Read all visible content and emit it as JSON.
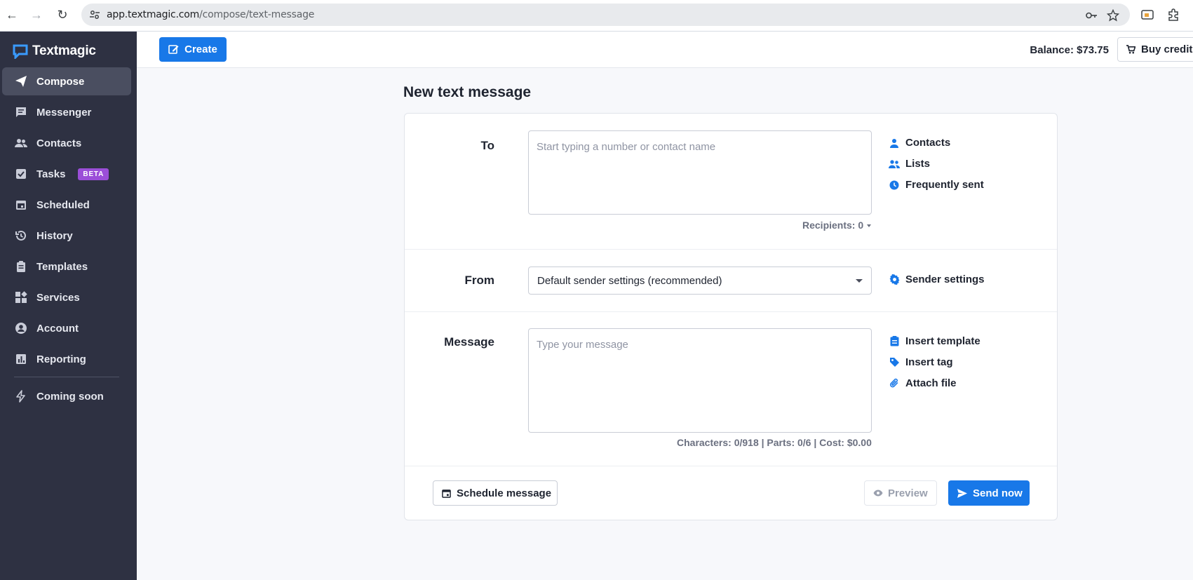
{
  "browser": {
    "url_host": "app.textmagic.com",
    "url_path": "/compose/text-message"
  },
  "brand": {
    "name": "Textmagic"
  },
  "sidebar": {
    "items": [
      {
        "label": "Compose",
        "icon": "send-icon",
        "active": true
      },
      {
        "label": "Messenger",
        "icon": "chat-icon"
      },
      {
        "label": "Contacts",
        "icon": "people-icon"
      },
      {
        "label": "Tasks",
        "icon": "checkbox-icon",
        "badge": "BETA"
      },
      {
        "label": "Scheduled",
        "icon": "calendar-icon"
      },
      {
        "label": "History",
        "icon": "history-icon"
      },
      {
        "label": "Templates",
        "icon": "clipboard-icon"
      },
      {
        "label": "Services",
        "icon": "widgets-icon"
      },
      {
        "label": "Account",
        "icon": "account-icon"
      },
      {
        "label": "Reporting",
        "icon": "chart-icon"
      },
      {
        "label": "Coming soon",
        "icon": "bolt-icon"
      }
    ]
  },
  "topbar": {
    "create_label": "Create",
    "balance": "Balance: $73.75",
    "buy_credit_label": "Buy credit"
  },
  "main": {
    "title": "New text message",
    "to": {
      "label": "To",
      "placeholder": "Start typing a number or contact name",
      "recipients": "Recipients: 0",
      "links": [
        "Contacts",
        "Lists",
        "Frequently sent"
      ]
    },
    "from": {
      "label": "From",
      "selected": "Default sender settings (recommended)",
      "link": "Sender settings"
    },
    "message": {
      "label": "Message",
      "placeholder": "Type your message",
      "stats": "Characters: 0/918 | Parts: 0/6 | Cost: $0.00",
      "links": [
        "Insert template",
        "Insert tag",
        "Attach file"
      ]
    },
    "actions": {
      "schedule_label": "Schedule message",
      "preview_label": "Preview",
      "send_label": "Send now"
    }
  },
  "colors": {
    "sidebar_bg": "#2e3142",
    "accent": "#1878e8",
    "beta": "#9b4ed8"
  }
}
